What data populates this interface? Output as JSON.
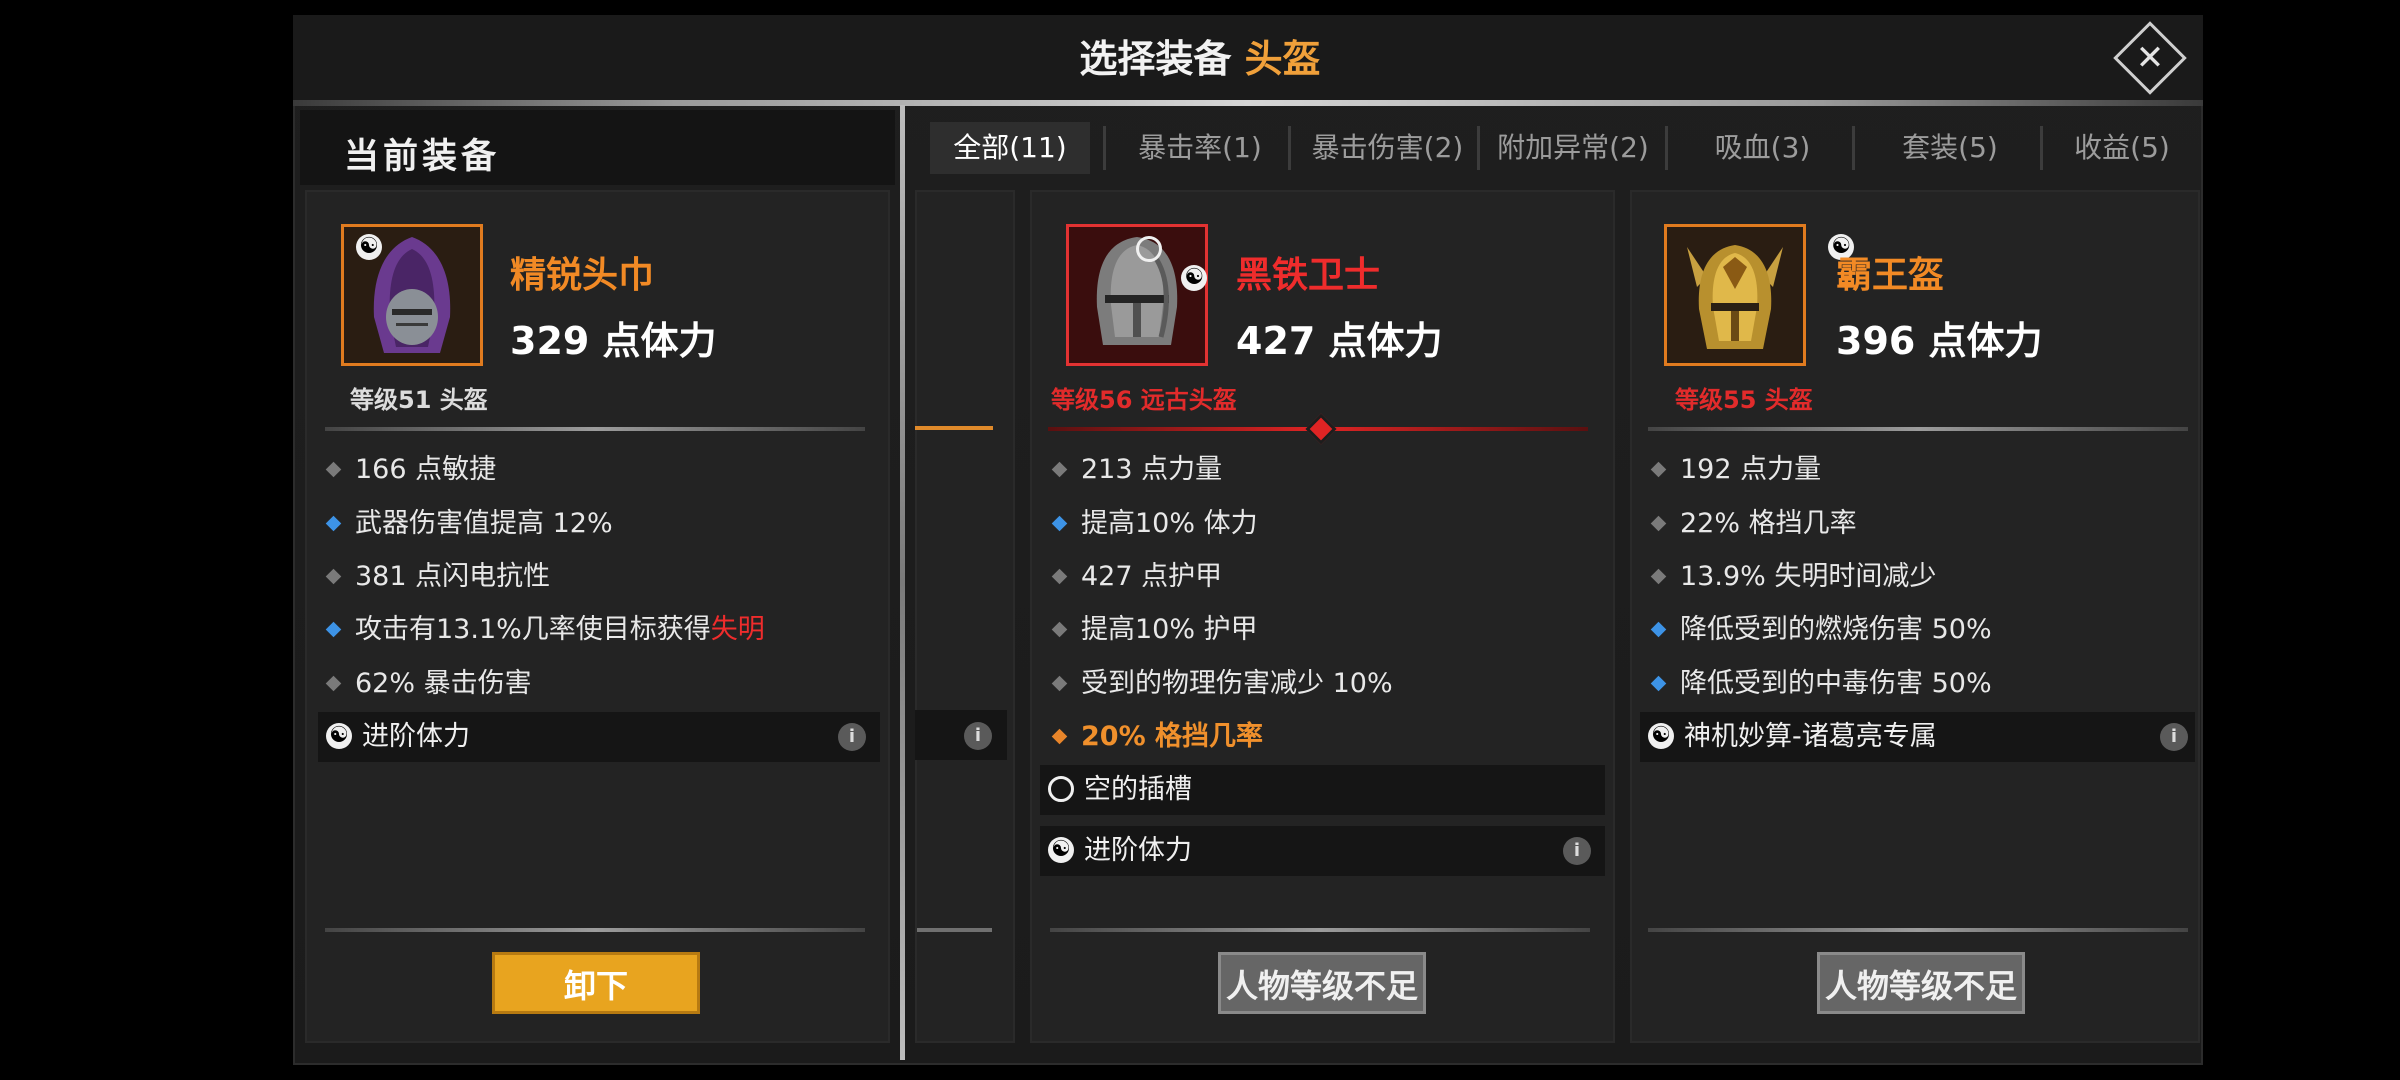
{
  "title": {
    "main": "选择装备",
    "accent": "头盔"
  },
  "current_section": "当前装备",
  "tabs": [
    "全部(11)",
    "暴击率(1)",
    "暴击伤害(2)",
    "附加异常(2)",
    "吸血(3)",
    "套装(5)",
    "收益(5)"
  ],
  "cards": [
    {
      "name": "精锐头巾",
      "main_stat": "329 点体力",
      "sub": "等级51 头盔",
      "stats": [
        {
          "text": "166 点敏捷",
          "bullet": "gray"
        },
        {
          "text": "武器伤害值提高 12%",
          "bullet": "blue"
        },
        {
          "text": "381 点闪电抗性",
          "bullet": "gray"
        },
        {
          "text": "攻击有13.1%几率使目标获得",
          "extra": "失明",
          "bullet": "blue"
        },
        {
          "text": "62% 暴击伤害",
          "bullet": "gray"
        }
      ],
      "socket": "进阶体力",
      "button": "卸下"
    },
    {
      "name": "黑铁卫士",
      "main_stat": "427 点体力",
      "sub": "等级56 远古头盔",
      "stats": [
        {
          "text": "213 点力量",
          "bullet": "gray"
        },
        {
          "text": "提高10% 体力",
          "bullet": "blue"
        },
        {
          "text": "427 点护甲",
          "bullet": "gray"
        },
        {
          "text": "提高10% 护甲",
          "bullet": "gray"
        },
        {
          "text": "受到的物理伤害减少 10%",
          "bullet": "gray"
        },
        {
          "text": "20% 格挡几率",
          "bullet": "orange"
        }
      ],
      "empty_slot": "空的插槽",
      "socket": "进阶体力",
      "button": "人物等级不足"
    },
    {
      "name": "霸王盔",
      "main_stat": "396 点体力",
      "sub": "等级55 头盔",
      "stats": [
        {
          "text": "192 点力量",
          "bullet": "gray"
        },
        {
          "text": "22% 格挡几率",
          "bullet": "gray"
        },
        {
          "text": "13.9% 失明时间减少",
          "bullet": "gray"
        },
        {
          "text": "降低受到的燃烧伤害 50%",
          "bullet": "blue"
        },
        {
          "text": "降低受到的中毒伤害 50%",
          "bullet": "blue"
        }
      ],
      "socket": "神机妙算-诸葛亮专属",
      "button": "人物等级不足"
    }
  ],
  "icons": {
    "close": "close-icon",
    "yinyang": "yin-yang-icon",
    "slot": "empty-slot-icon",
    "info": "info-icon"
  },
  "colors": {
    "accent": "#f0a03a",
    "ancient": "#ef2c2c",
    "legendary": "#f28a25",
    "magic": "#3d93e6"
  }
}
